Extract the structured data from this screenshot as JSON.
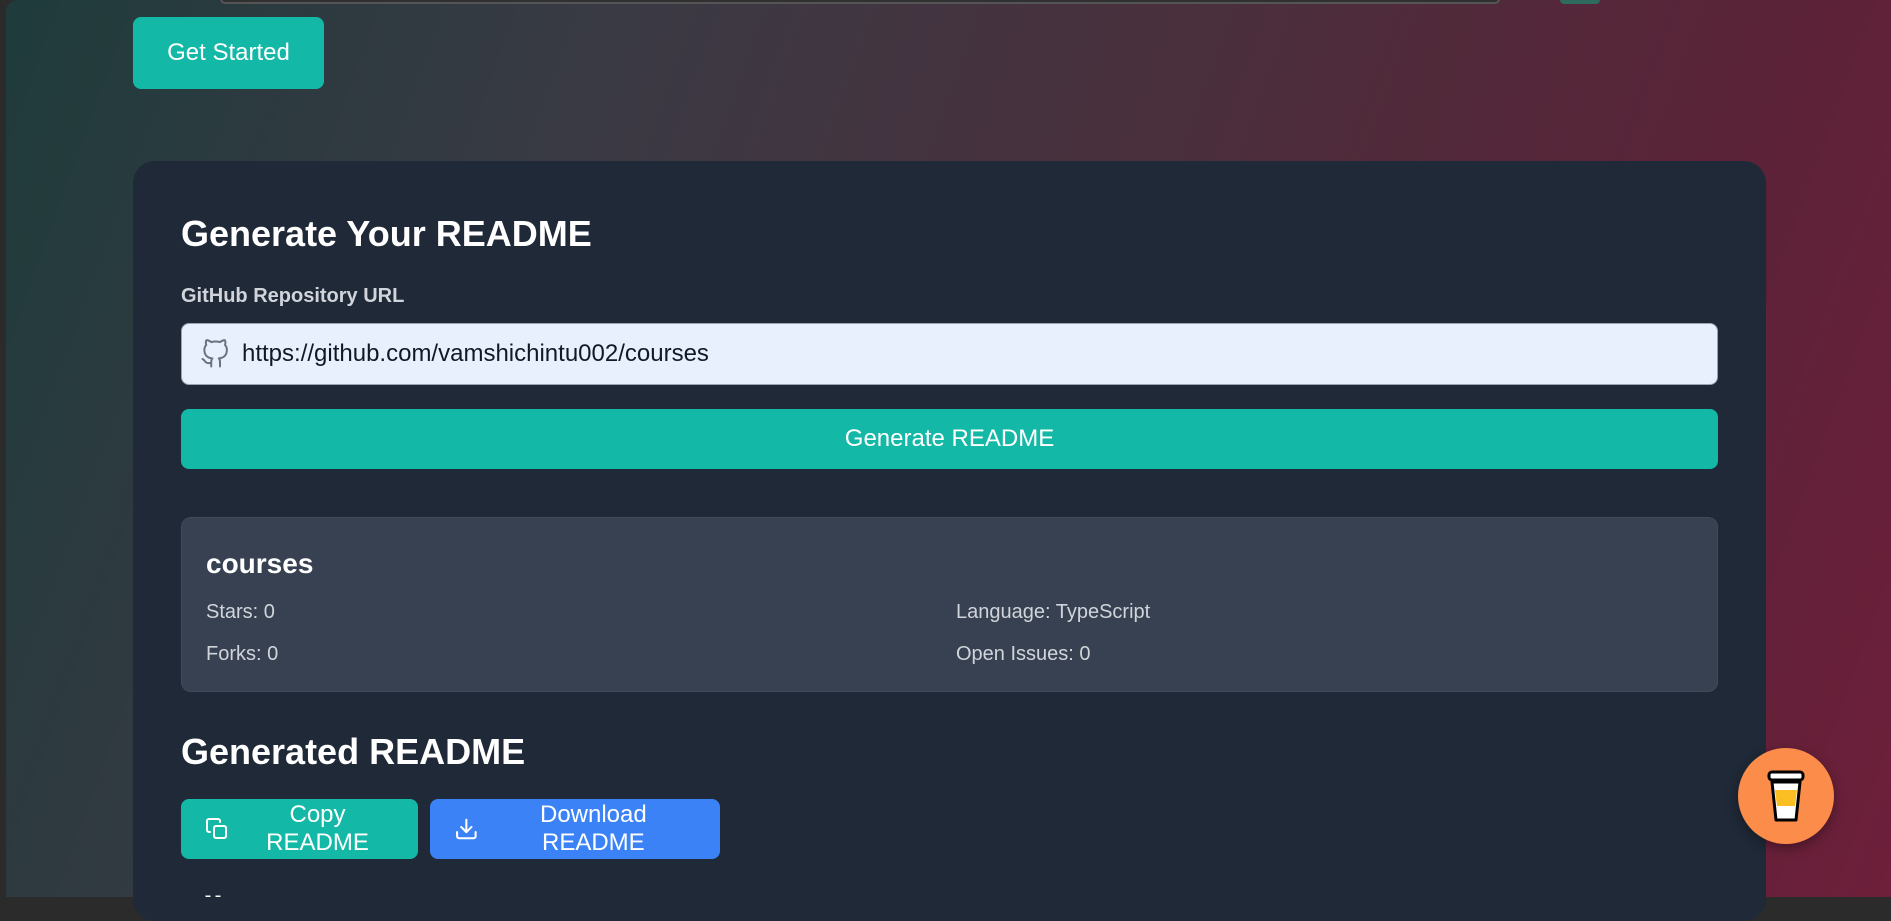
{
  "header": {
    "get_started_label": "Get Started"
  },
  "form": {
    "title": "Generate Your README",
    "url_label": "GitHub Repository URL",
    "url_value": "https://github.com/vamshichintu002/courses",
    "generate_label": "Generate README"
  },
  "repo": {
    "name": "courses",
    "stars": "Stars: 0",
    "forks": "Forks: 0",
    "language": "Language: TypeScript",
    "issues": "Open Issues: 0"
  },
  "generated": {
    "title": "Generated README",
    "copy_label": "Copy README",
    "download_label": "Download README",
    "partial_text": "Fil"
  },
  "colors": {
    "accent": "#14b8a6",
    "download": "#3b82f6",
    "card": "#1f2937",
    "panel": "#374151",
    "coffee": "#fb8c4a"
  },
  "icons": [
    "github-icon",
    "copy-icon",
    "download-icon",
    "coffee-cup-icon"
  ]
}
